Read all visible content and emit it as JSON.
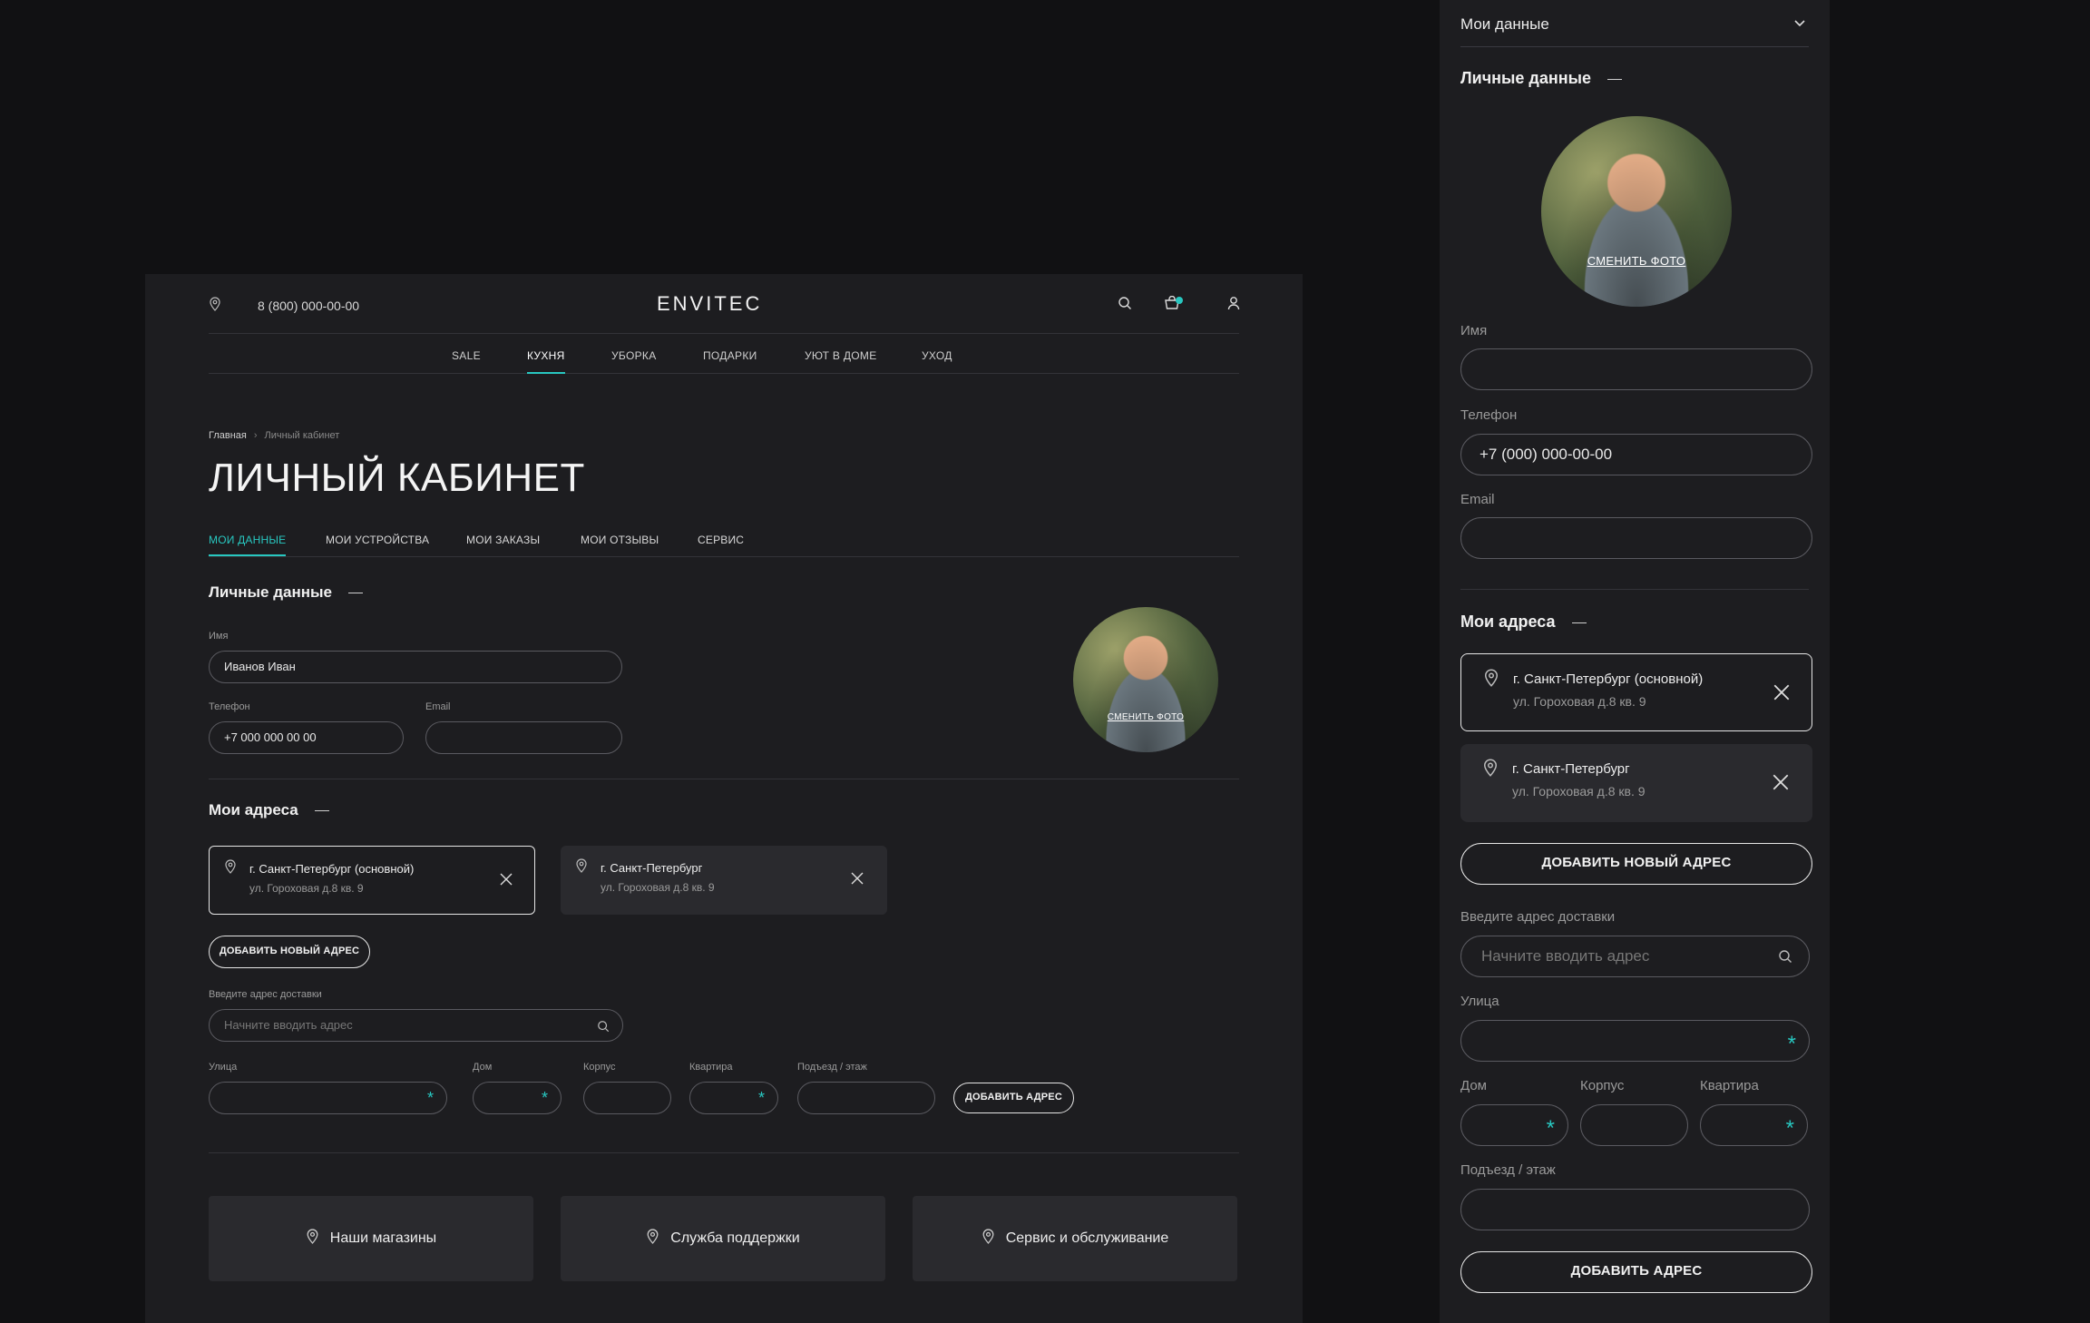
{
  "header": {
    "phone": "8 (800) 000-00-00",
    "logo": "ENVITEC"
  },
  "nav": [
    "SALE",
    "КУХНЯ",
    "УБОРКА",
    "ПОДАРКИ",
    "УЮТ В ДОМЕ",
    "УХОД"
  ],
  "nav_active": "КУХНЯ",
  "breadcrumb": {
    "home": "Главная",
    "current": "Личный кабинет"
  },
  "page_title": "ЛИЧНЫЙ КАБИНЕТ",
  "tabs": [
    "МОИ ДАННЫЕ",
    "МОИ УСТРОЙСТВА",
    "МОИ ЗАКАЗЫ",
    "МОИ ОТЗЫВЫ",
    "СЕРВИС"
  ],
  "tab_active": "МОИ ДАННЫЕ",
  "personal": {
    "title": "Личные данные",
    "name_label": "Имя",
    "name_value": "Иванов Иван",
    "phone_label": "Телефон",
    "phone_value": "+7 000 000 00 00",
    "email_label": "Email",
    "email_value": "",
    "change_photo": "СМЕНИТЬ ФОТО"
  },
  "addresses": {
    "title": "Мои адреса",
    "items": [
      {
        "city": "г. Санкт-Петербург (основной)",
        "street": "ул. Гороховая д.8 кв. 9",
        "selected": true
      },
      {
        "city": "г. Санкт-Петербург",
        "street": "ул. Гороховая д.8 кв. 9",
        "selected": false
      }
    ],
    "add_new": "ДОБАВИТЬ НОВЫЙ АДРЕС",
    "delivery_label": "Введите адрес доставки",
    "delivery_placeholder": "Начните вводить адрес",
    "street_label": "Улица",
    "house_label": "Дом",
    "building_label": "Корпус",
    "flat_label": "Квартира",
    "entrance_label": "Подъезд / этаж",
    "add_address": "ДОБАВИТЬ АДРЕС"
  },
  "footer_links": [
    "Наши магазины",
    "Служба поддержки",
    "Сервис и обслуживание"
  ],
  "mobile": {
    "dropdown_label": "Мои данные",
    "phone_value": "+7 (000) 000-00-00"
  },
  "colors": {
    "accent": "#28c7c0",
    "background": "#111113",
    "panel": "#1d1d20",
    "card": "#2a2a2e"
  }
}
